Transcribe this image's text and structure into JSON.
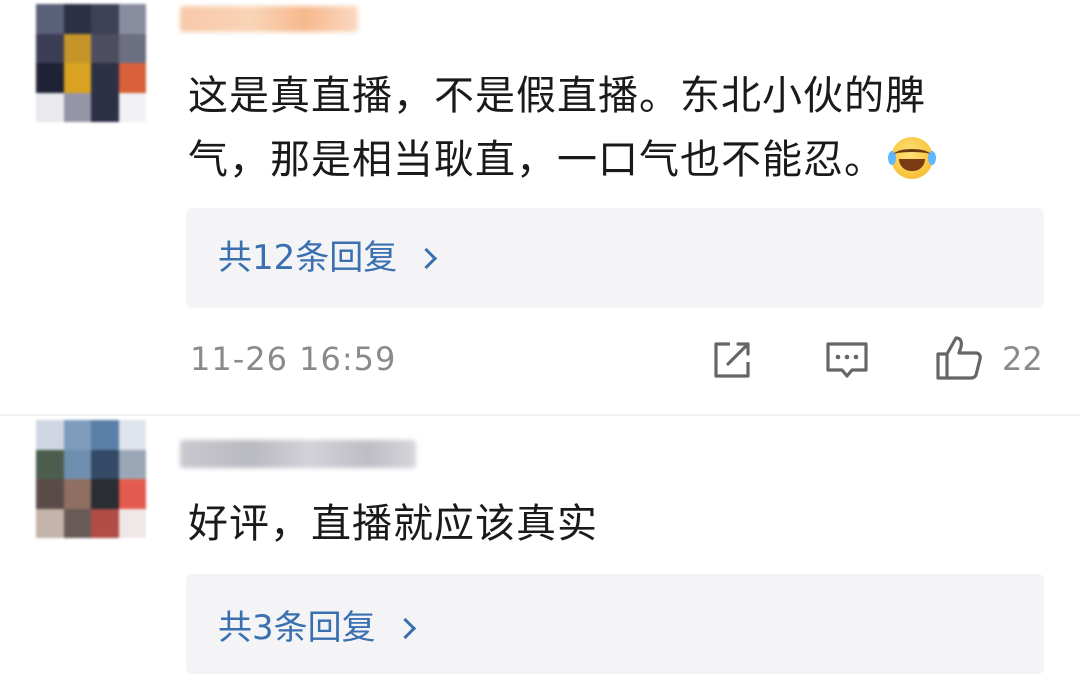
{
  "comments": [
    {
      "text_line1": "这是真直播，不是假直播。东北小伙的脾",
      "text_line2": "气，那是相当耿直，一口气也不能忍。",
      "emoji": "laughing-crying-emoji",
      "replies_label": "共12条回复",
      "time": "11-26 16:59",
      "likes": "22"
    },
    {
      "text": "好评，直播就应该真实",
      "replies_label": "共3条回复"
    }
  ],
  "icons": {
    "share": "share-icon",
    "comment": "comment-icon",
    "like": "thumbs-up-icon",
    "chevron": "chevron-right-icon"
  },
  "colors": {
    "link": "#3a6fb0",
    "meta": "#8a8a8a",
    "reply_bg": "#f4f4f6"
  }
}
